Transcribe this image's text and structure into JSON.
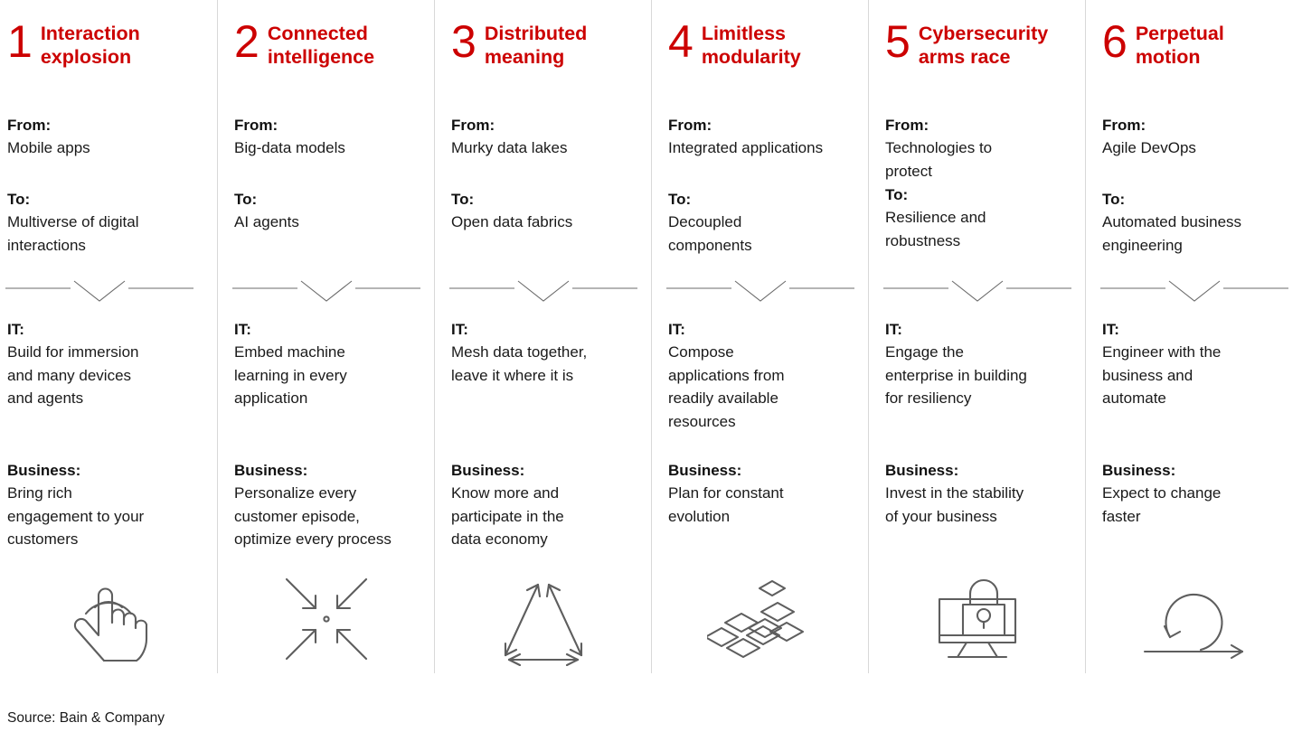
{
  "theme": {
    "accent_red": "#cc0000",
    "text": "#1a1a1a",
    "divider_gray": "#d8d8d8",
    "icon_gray": "#5e5e5e"
  },
  "labels": {
    "from": "From:",
    "to": "To:",
    "it": "IT:",
    "business": "Business:"
  },
  "columns": [
    {
      "number": "1",
      "title": "Interaction\nexplosion",
      "from": "Mobile apps",
      "to": "Multiverse of digital\ninteractions",
      "it": "Build for immersion\nand many devices\nand agents",
      "business": "Bring rich\nengagement to your\ncustomers",
      "icon": "tap-gesture-icon"
    },
    {
      "number": "2",
      "title": "Connected\nintelligence",
      "from": "Big-data models",
      "to": "AI agents",
      "it": "Embed machine\nlearning in every\napplication",
      "business": "Personalize every\ncustomer episode,\noptimize every process",
      "icon": "converging-arrows-icon"
    },
    {
      "number": "3",
      "title": "Distributed\nmeaning",
      "from": "Murky data lakes",
      "to": "Open data fabrics",
      "it": "Mesh data together,\nleave it where it is",
      "business": "Know more and\nparticipate in the\ndata economy",
      "icon": "triangle-network-icon"
    },
    {
      "number": "4",
      "title": "Limitless\nmodularity",
      "from": "Integrated applications",
      "to": "Decoupled\ncomponents",
      "it": "Compose\napplications from\nreadily available\nresources",
      "business": "Plan for constant\nevolution",
      "icon": "modular-blocks-icon"
    },
    {
      "number": "5",
      "title": "Cybersecurity\narms race",
      "from": "Technologies to\nprotect",
      "to": "Resilience and\nrobustness",
      "it": "Engage the\nenterprise in building\nfor resiliency",
      "business": "Invest in the stability\nof your business",
      "icon": "monitor-lock-icon"
    },
    {
      "number": "6",
      "title": "Perpetual\nmotion",
      "from": "Agile DevOps",
      "to": "Automated business\nengineering",
      "it": "Engineer with the\nbusiness and\nautomate",
      "business": "Expect to change\nfaster",
      "icon": "perpetual-loop-icon"
    }
  ],
  "footer": {
    "source": "Source: Bain & Company"
  }
}
